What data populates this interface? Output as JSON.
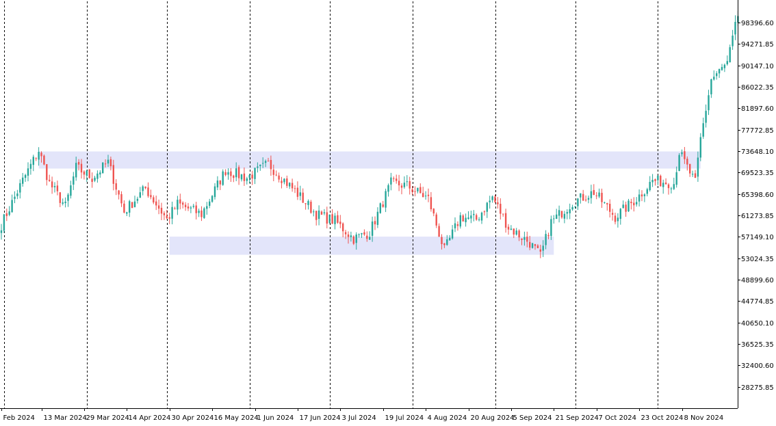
{
  "colors": {
    "bull": "#26a69a",
    "bear": "#ef5350",
    "zone": "#e3e5fa",
    "grid": "#000000",
    "axis": "#000000",
    "background": "#ffffff"
  },
  "chart_data": {
    "type": "candlestick",
    "title": "",
    "xlabel": "",
    "ylabel": "",
    "ylim": [
      24150,
      102500
    ],
    "y_ticks": [
      98396.6,
      94271.85,
      90147.1,
      86022.35,
      81897.6,
      77772.85,
      73648.1,
      69523.35,
      65398.6,
      61273.85,
      57149.1,
      53024.35,
      48899.6,
      44774.85,
      40650.1,
      36525.35,
      32400.6,
      28275.85
    ],
    "x_ticks": [
      "Feb 2024",
      "13 Mar 2024",
      "29 Mar 2024",
      "14 Apr 2024",
      "30 Apr 2024",
      "16 May 2024",
      "1 Jun 2024",
      "17 Jun 2024",
      "3 Jul 2024",
      "19 Jul 2024",
      "4 Aug 2024",
      "20 Aug 2024",
      "5 Sep 2024",
      "21 Sep 2024",
      "7 Oct 2024",
      "23 Oct 2024",
      "8 Nov 2024"
    ],
    "x_tick_index": [
      0,
      15,
      31,
      47,
      63,
      79,
      95,
      111,
      127,
      143,
      159,
      175,
      191,
      207,
      223,
      239,
      255
    ],
    "separators_index": [
      1,
      32,
      62,
      93,
      123,
      154,
      185,
      215,
      246
    ],
    "zones": [
      {
        "start_index": 14,
        "end_index": 262,
        "low": 70300,
        "high": 73600
      },
      {
        "start_index": 63,
        "end_index": 207,
        "low": 53700,
        "high": 57200
      }
    ],
    "ohlc_keypoints": [
      [
        0,
        59500
      ],
      [
        8,
        68000
      ],
      [
        14,
        73800
      ],
      [
        18,
        67500
      ],
      [
        24,
        63000
      ],
      [
        28,
        70500
      ],
      [
        34,
        68500
      ],
      [
        40,
        71500
      ],
      [
        46,
        62000
      ],
      [
        54,
        66500
      ],
      [
        62,
        60500
      ],
      [
        66,
        63500
      ],
      [
        75,
        61500
      ],
      [
        84,
        70000
      ],
      [
        92,
        68500
      ],
      [
        100,
        71200
      ],
      [
        110,
        66000
      ],
      [
        118,
        61500
      ],
      [
        125,
        60200
      ],
      [
        132,
        56800
      ],
      [
        138,
        58000
      ],
      [
        146,
        67500
      ],
      [
        152,
        67000
      ],
      [
        160,
        64500
      ],
      [
        166,
        54500
      ],
      [
        172,
        61000
      ],
      [
        178,
        60500
      ],
      [
        184,
        64800
      ],
      [
        190,
        59000
      ],
      [
        198,
        56000
      ],
      [
        202,
        53400
      ],
      [
        206,
        60000
      ],
      [
        214,
        63800
      ],
      [
        222,
        65800
      ],
      [
        230,
        61000
      ],
      [
        238,
        64500
      ],
      [
        244,
        68000
      ],
      [
        252,
        67500
      ],
      [
        254,
        73500
      ],
      [
        260,
        67500
      ],
      [
        262,
        76000
      ],
      [
        266,
        87500
      ],
      [
        272,
        90500
      ],
      [
        276,
        99800
      ]
    ]
  }
}
